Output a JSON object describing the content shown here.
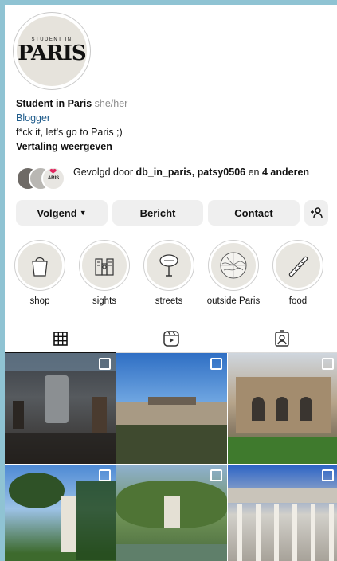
{
  "profile": {
    "avatar_top": "STUDENT IN",
    "avatar_main": "PARIS",
    "name": "Student in Paris",
    "pronouns": "she/her",
    "category": "Blogger",
    "bio": "f*ck it, let's go to Paris ;)",
    "translate": "Vertaling weergeven"
  },
  "followers": {
    "prefix": "Gevolgd door",
    "names": "db_in_paris, patsy0506",
    "connector": "en",
    "others": "4 anderen",
    "mini_badge": "ARIS"
  },
  "actions": {
    "follow_label": "Volgend",
    "message_label": "Bericht",
    "contact_label": "Contact",
    "add_user_glyph": "+👤"
  },
  "highlights": [
    {
      "label": "shop",
      "icon": "tote-bag-icon"
    },
    {
      "label": "sights",
      "icon": "notre-dame-icon"
    },
    {
      "label": "streets",
      "icon": "street-sign-icon"
    },
    {
      "label": "outside Paris",
      "icon": "map-icon"
    },
    {
      "label": "food",
      "icon": "baguette-icon"
    }
  ],
  "tabs": [
    "grid-icon",
    "reels-icon",
    "tagged-icon"
  ],
  "posts": [
    {
      "icon": "carousel-icon"
    },
    {
      "icon": "carousel-icon"
    },
    {
      "icon": "carousel-icon"
    },
    {
      "icon": "carousel-icon"
    },
    {
      "icon": "carousel-icon"
    },
    {
      "icon": "carousel-icon"
    }
  ]
}
